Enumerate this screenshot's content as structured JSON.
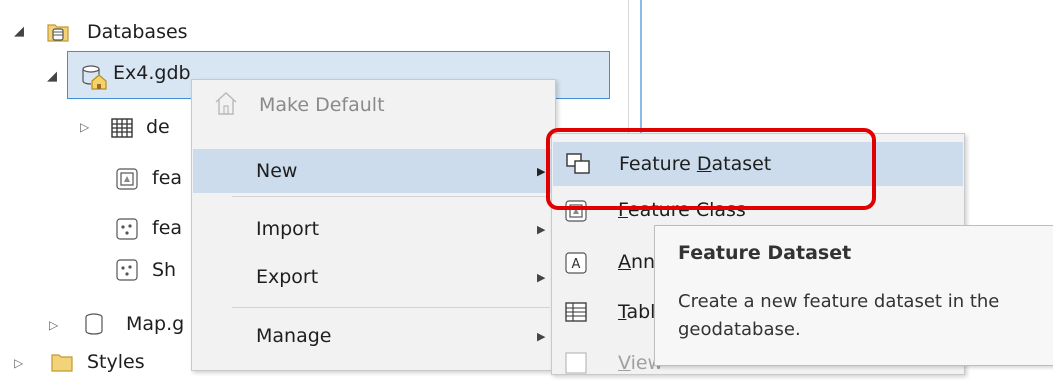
{
  "tree": {
    "databases_label": "Databases",
    "gdb_label": "Ex4.gdb",
    "children": [
      "de",
      "fea",
      "fea",
      "Sh"
    ],
    "map_label": "Map.g",
    "styles_label": "Styles"
  },
  "context_menu": {
    "make_default": "Make Default",
    "new": "New",
    "import": "Import",
    "export": "Export",
    "manage": "Manage"
  },
  "submenu": {
    "feature_dataset_pre": "Feature ",
    "feature_dataset_ul": "D",
    "feature_dataset_post": "ataset",
    "feature_class_ul": "F",
    "feature_class_post": "eature Class",
    "annotation_ul": "A",
    "annotation_post": "nnotation",
    "table_ul": "T",
    "table_post": "able",
    "view_ul": "V",
    "view_post": "iew"
  },
  "tooltip": {
    "title": "Feature Dataset",
    "body_line1": "Create a new feature dataset in the",
    "body_line2": "geodatabase."
  },
  "colors": {
    "highlight": "#ccdcec",
    "selection_border": "#3f8fd6",
    "annotation_red": "#e00000"
  }
}
